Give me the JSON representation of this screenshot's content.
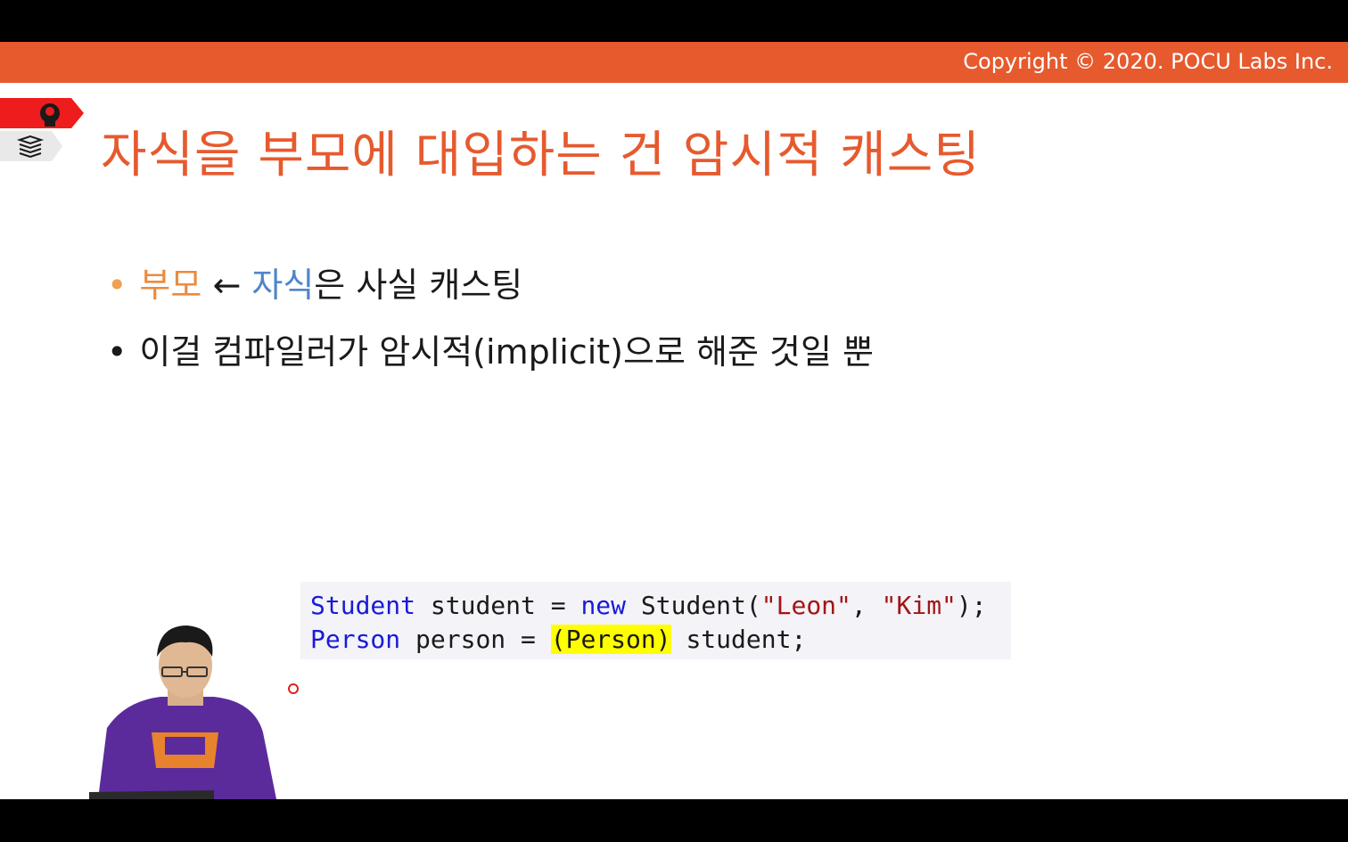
{
  "header": {
    "copyright": "Copyright © 2020. POCU Labs Inc."
  },
  "slide": {
    "title": "자식을 부모에 대입하는 건 암시적 캐스팅",
    "bullets": [
      {
        "part1": "부모",
        "arrow": "←",
        "part2": "자식",
        "part3": "은 사실 캐스팅"
      },
      {
        "text": "이걸 컴파일러가 암시적(implicit)으로 해준 것일 뿐"
      }
    ],
    "bullet_symbol": "•"
  },
  "code": {
    "line1": {
      "type1": "Student",
      "rest1": " student = ",
      "kw": "new",
      "rest2": " Student(",
      "str1": "\"Leon\"",
      "comma": ", ",
      "str2": "\"Kim\"",
      "end": ");"
    },
    "line2": {
      "type": "Person",
      "rest1": " person = ",
      "cast": "(Person)",
      "rest2": " student;"
    }
  },
  "colors": {
    "accent": "#e65a2e",
    "highlight": "#ffff00",
    "keyword": "#1a1ad6",
    "string": "#a31515"
  },
  "icons": {
    "badge_top": "brain-head-icon",
    "badge_bottom": "book-stack-icon"
  }
}
